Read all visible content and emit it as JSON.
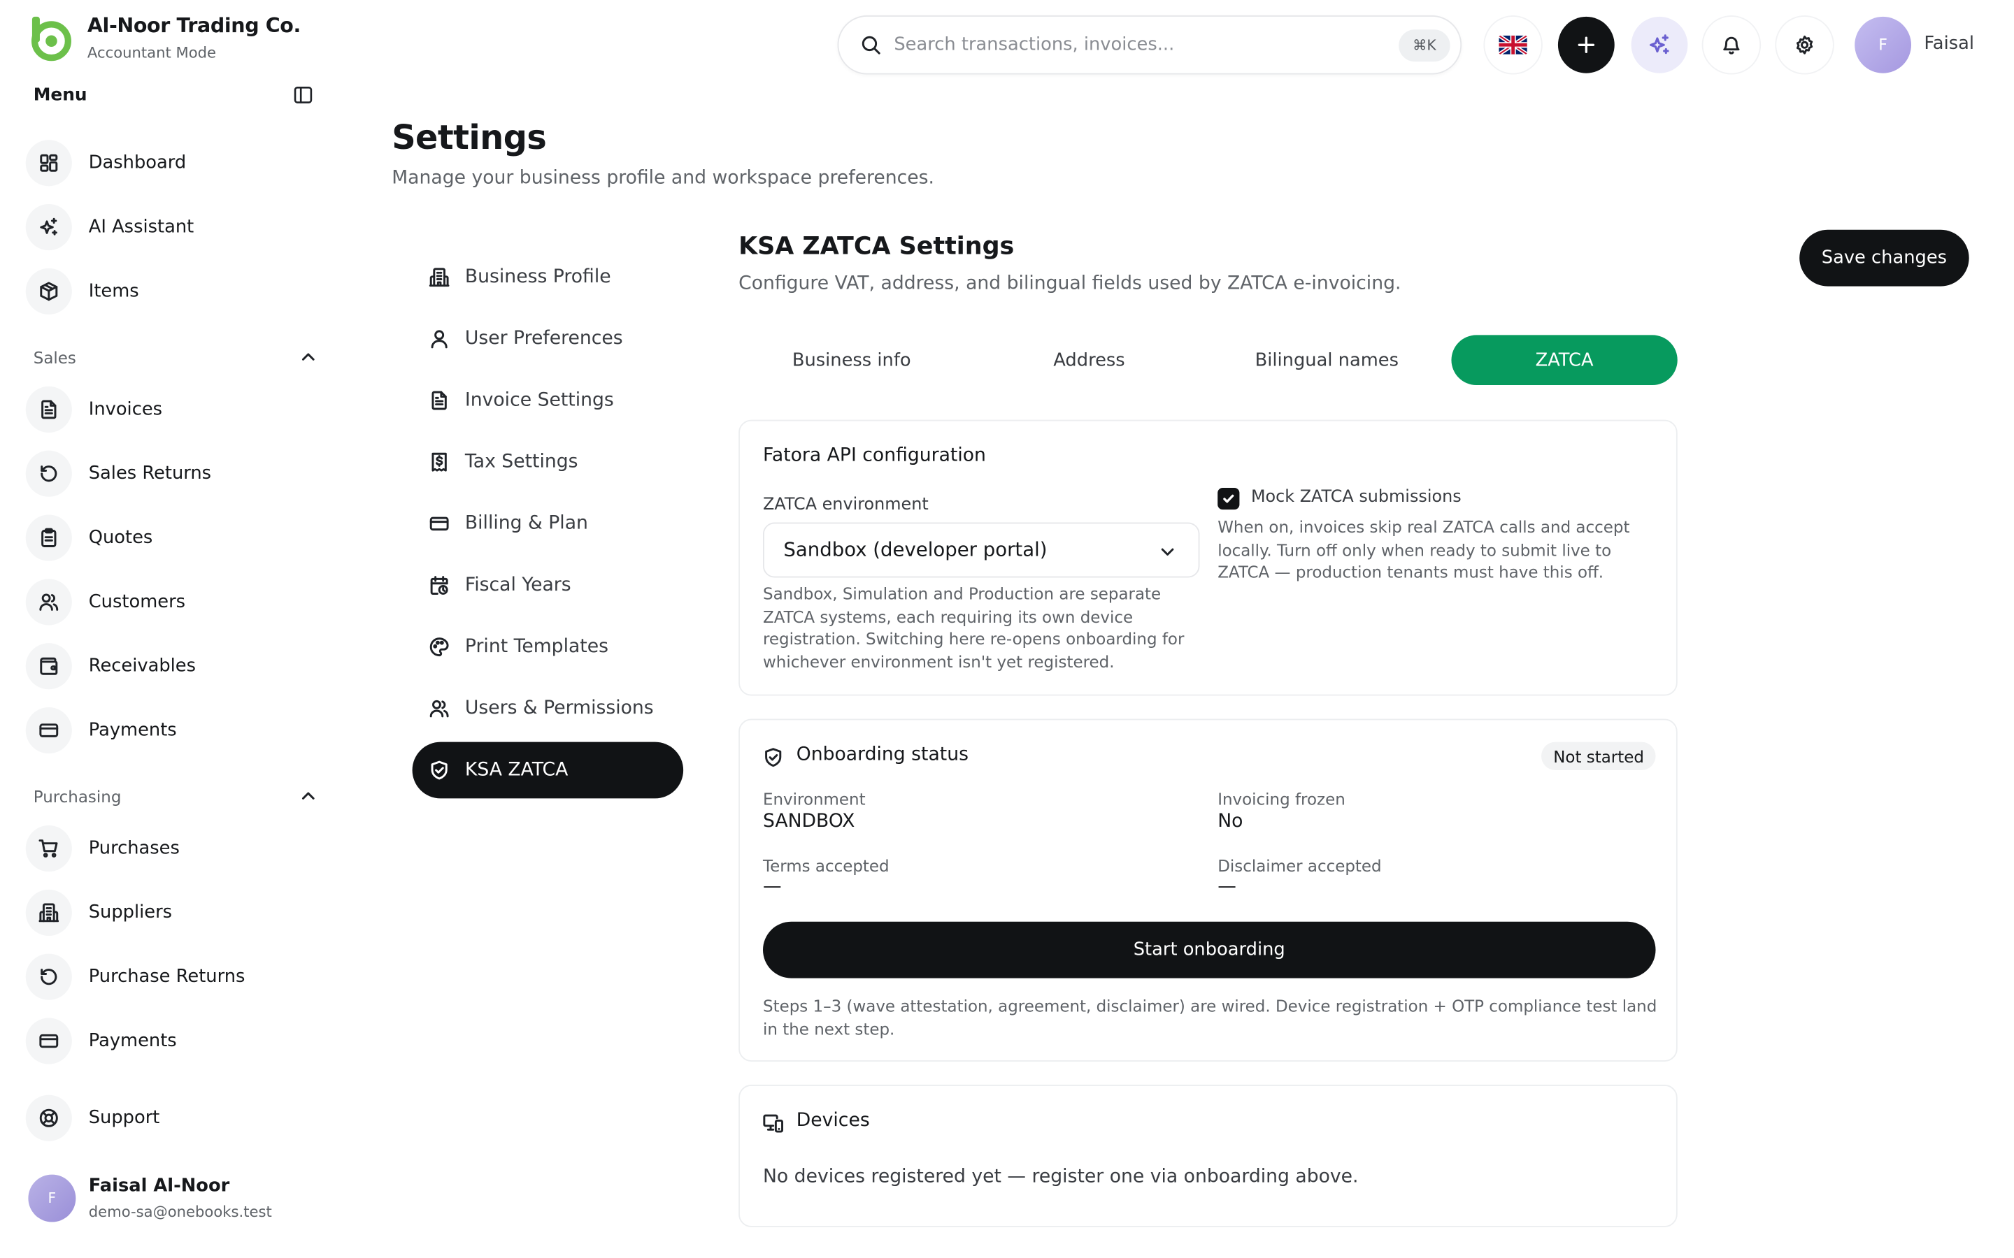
{
  "brand": {
    "name": "Al-Noor Trading Co.",
    "mode": "Accountant Mode"
  },
  "sidebar": {
    "menu_title": "Menu",
    "top_items": [
      {
        "label": "Dashboard",
        "icon": "dashboard-icon"
      },
      {
        "label": "AI Assistant",
        "icon": "sparkles-icon"
      },
      {
        "label": "Items",
        "icon": "box-icon"
      }
    ],
    "sales": {
      "title": "Sales",
      "items": [
        {
          "label": "Invoices",
          "icon": "file-text-icon"
        },
        {
          "label": "Sales Returns",
          "icon": "rotate-ccw-icon"
        },
        {
          "label": "Quotes",
          "icon": "clipboard-icon"
        },
        {
          "label": "Customers",
          "icon": "users-icon"
        },
        {
          "label": "Receivables",
          "icon": "wallet-icon"
        },
        {
          "label": "Payments",
          "icon": "credit-card-icon"
        }
      ]
    },
    "purchasing": {
      "title": "Purchasing",
      "items": [
        {
          "label": "Purchases",
          "icon": "cart-icon"
        },
        {
          "label": "Suppliers",
          "icon": "building-icon"
        },
        {
          "label": "Purchase Returns",
          "icon": "rotate-ccw-icon"
        },
        {
          "label": "Payments",
          "icon": "credit-card-icon"
        }
      ]
    },
    "support": {
      "label": "Support",
      "icon": "life-buoy-icon"
    },
    "user": {
      "initial": "F",
      "name": "Faisal Al-Noor",
      "email": "demo-sa@onebooks.test"
    }
  },
  "topbar": {
    "search_placeholder": "Search transactions, invoices...",
    "shortcut": "⌘K",
    "language_icon": "uk-flag-icon",
    "user_initial": "F",
    "user_name": "Faisal"
  },
  "page": {
    "title": "Settings",
    "subtitle": "Manage your business profile and workspace preferences."
  },
  "settings_nav": [
    {
      "label": "Business Profile",
      "icon": "building-icon",
      "active": false
    },
    {
      "label": "User Preferences",
      "icon": "user-icon",
      "active": false
    },
    {
      "label": "Invoice Settings",
      "icon": "file-text-icon",
      "active": false
    },
    {
      "label": "Tax Settings",
      "icon": "receipt-dollar-icon",
      "active": false
    },
    {
      "label": "Billing & Plan",
      "icon": "credit-card-icon",
      "active": false
    },
    {
      "label": "Fiscal Years",
      "icon": "calendar-clock-icon",
      "active": false
    },
    {
      "label": "Print Templates",
      "icon": "palette-icon",
      "active": false
    },
    {
      "label": "Users & Permissions",
      "icon": "users-icon",
      "active": false
    },
    {
      "label": "KSA ZATCA",
      "icon": "shield-check-icon",
      "active": true
    }
  ],
  "section": {
    "title": "KSA ZATCA Settings",
    "subtitle": "Configure VAT, address, and bilingual fields used by ZATCA e-invoicing.",
    "save_label": "Save changes",
    "tabs": [
      {
        "label": "Business info",
        "active": false
      },
      {
        "label": "Address",
        "active": false
      },
      {
        "label": "Bilingual names",
        "active": false
      },
      {
        "label": "ZATCA",
        "active": true
      }
    ]
  },
  "fatora": {
    "title": "Fatora API configuration",
    "env_label": "ZATCA environment",
    "env_value": "Sandbox (developer portal)",
    "env_help": "Sandbox, Simulation and Production are separate ZATCA systems, each requiring its own device registration. Switching here re-opens onboarding for whichever environment isn't yet registered.",
    "mock_label": "Mock ZATCA submissions",
    "mock_checked": true,
    "mock_help": "When on, invoices skip real ZATCA calls and accept locally. Turn off only when ready to submit live to ZATCA — production tenants must have this off."
  },
  "onboarding": {
    "title": "Onboarding status",
    "status_badge": "Not started",
    "fields": [
      {
        "label": "Environment",
        "value": "SANDBOX"
      },
      {
        "label": "Invoicing frozen",
        "value": "No"
      },
      {
        "label": "Terms accepted",
        "value": "—"
      },
      {
        "label": "Disclaimer accepted",
        "value": "—"
      }
    ],
    "button_label": "Start onboarding",
    "note": "Steps 1–3 (wave attestation, agreement, disclaimer) are wired. Device registration + OTP compliance test land in the next step."
  },
  "devices": {
    "title": "Devices",
    "empty_text": "No devices registered yet — register one via onboarding above."
  },
  "colors": {
    "accent_green": "#079a5e",
    "brand_green": "#6cc04a",
    "dark": "#111315"
  }
}
